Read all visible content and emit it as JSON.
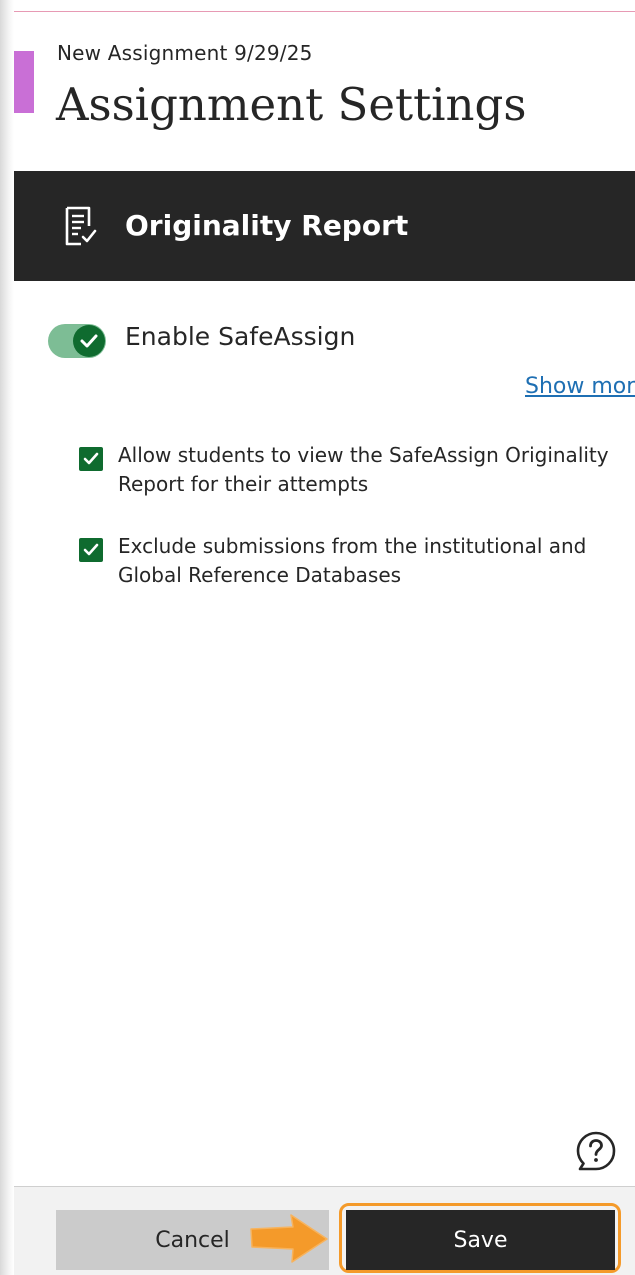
{
  "panel": {
    "breadcrumb": "New Assignment 9/29/25",
    "title": "Assignment Settings",
    "accent_color": "#c96fd6"
  },
  "section": {
    "title": "Originality Report",
    "icon": "document-checklist-icon"
  },
  "safeassign": {
    "toggle_label": "Enable SafeAssign",
    "enabled": true,
    "show_more_label": "Show more"
  },
  "options": [
    {
      "label": "Allow students to view the SafeAssign Originality Report for their attempts",
      "checked": true
    },
    {
      "label": "Exclude submissions from the institutional and Global Reference Databases",
      "checked": true
    }
  ],
  "help": {
    "icon": "help-question-icon"
  },
  "footer": {
    "cancel_label": "Cancel",
    "save_label": "Save"
  },
  "colors": {
    "check_green": "#0f6b2f",
    "toggle_track": "#7dbd95",
    "header_dark": "#262626",
    "link_blue": "#1e6fb3",
    "highlight_orange": "#f49a2a"
  }
}
